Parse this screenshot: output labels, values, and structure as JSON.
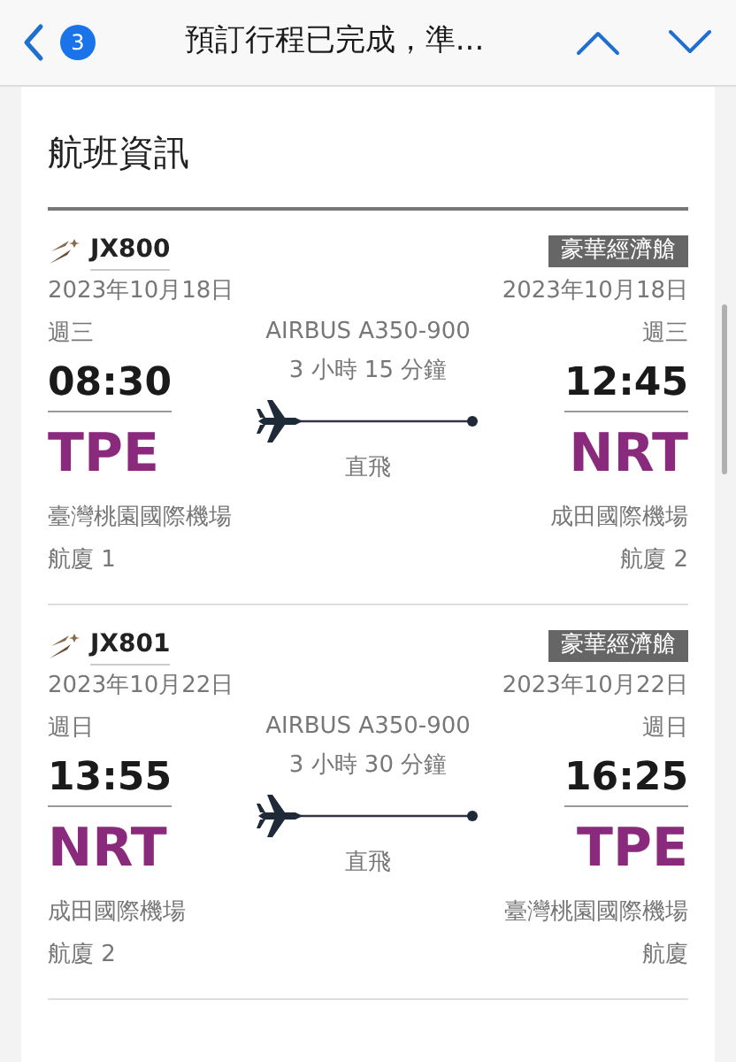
{
  "header": {
    "unread_count": "3",
    "title": "預訂行程已完成，準..."
  },
  "section_title": "航班資訊",
  "flights": [
    {
      "flight_number": "JX800",
      "cabin": "豪華經濟艙",
      "aircraft": "AIRBUS A350-900",
      "duration": "3 小時 15 分鐘",
      "stops": "直飛",
      "departure": {
        "date": "2023年10月18日",
        "weekday": "週三",
        "time": "08:30",
        "code": "TPE",
        "airport": "臺灣桃園國際機場",
        "terminal": "航廈 1"
      },
      "arrival": {
        "date": "2023年10月18日",
        "weekday": "週三",
        "time": "12:45",
        "code": "NRT",
        "airport": "成田國際機場",
        "terminal": "航廈 2"
      }
    },
    {
      "flight_number": "JX801",
      "cabin": "豪華經濟艙",
      "aircraft": "AIRBUS A350-900",
      "duration": "3 小時 30 分鐘",
      "stops": "直飛",
      "departure": {
        "date": "2023年10月22日",
        "weekday": "週日",
        "time": "13:55",
        "code": "NRT",
        "airport": "成田國際機場",
        "terminal": "航廈 2"
      },
      "arrival": {
        "date": "2023年10月22日",
        "weekday": "週日",
        "time": "16:25",
        "code": "TPE",
        "airport": "臺灣桃園國際機場",
        "terminal": "航廈"
      }
    }
  ]
}
